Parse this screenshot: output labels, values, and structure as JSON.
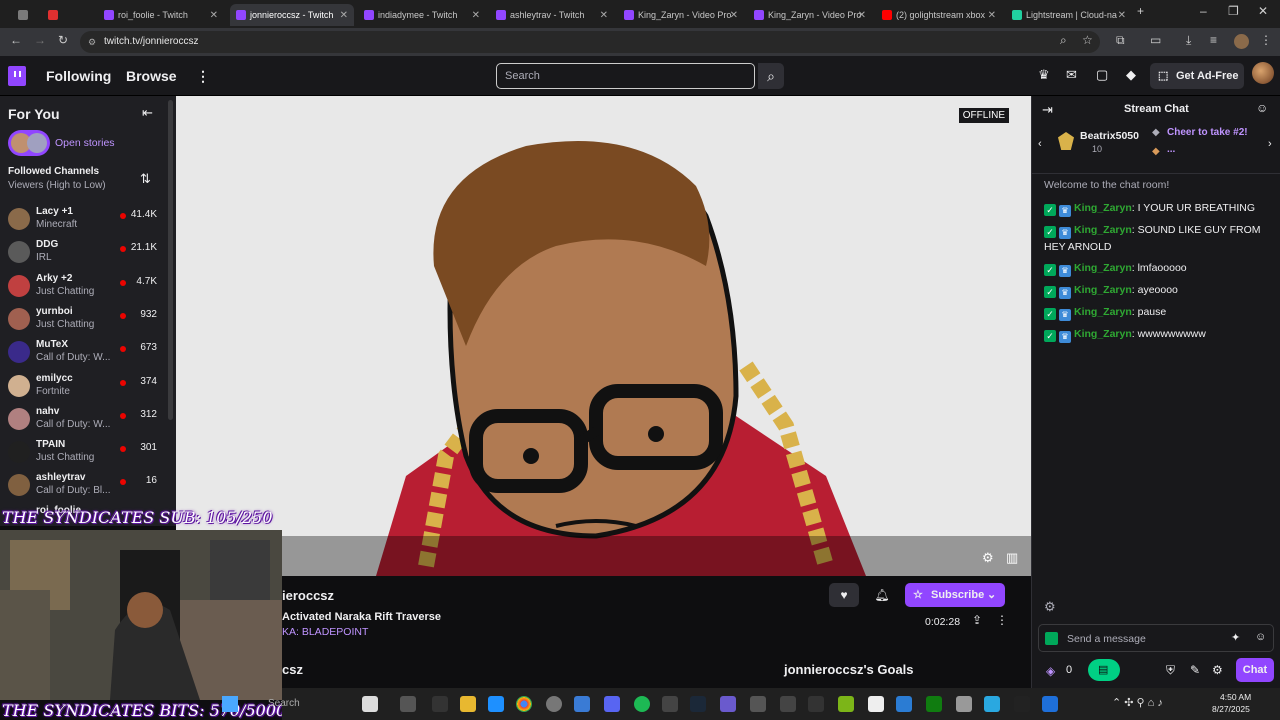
{
  "browser": {
    "tabs": [
      {
        "label": "",
        "color": "#7a7a7a"
      },
      {
        "label": "",
        "color": "#e03030"
      },
      {
        "label": "roi_foolie - Twitch",
        "color": "#9146ff"
      },
      {
        "label": "jonnieroccsz - Twitch",
        "color": "#9146ff"
      },
      {
        "label": "indiadymee - Twitch",
        "color": "#9146ff"
      },
      {
        "label": "ashleytrav - Twitch",
        "color": "#9146ff"
      },
      {
        "label": "King_Zaryn - Video Pro",
        "color": "#9146ff"
      },
      {
        "label": "King_Zaryn - Video Pro",
        "color": "#9146ff"
      },
      {
        "label": "(2) golightstream xbox",
        "color": "#ff0000"
      },
      {
        "label": "Lightstream | Cloud-na",
        "color": "#21d0a0"
      }
    ],
    "url": "twitch.tv/jonnieroccsz"
  },
  "nav": {
    "following": "Following",
    "browse": "Browse",
    "search_placeholder": "Search",
    "get_ad_free": "Get Ad-Free"
  },
  "sidebar": {
    "for_you": "For You",
    "open_stories": "Open stories",
    "followed_title": "Followed Channels",
    "followed_sort": "Viewers (High to Low)",
    "channels": [
      {
        "name": "Lacy +1",
        "game": "Minecraft",
        "viewers": "41.4K",
        "color": "#8a6a4a"
      },
      {
        "name": "DDG",
        "game": "IRL",
        "viewers": "21.1K",
        "color": "#5a5a5a"
      },
      {
        "name": "Arky +2",
        "game": "Just Chatting",
        "viewers": "4.7K",
        "color": "#c04040"
      },
      {
        "name": "yurnboi",
        "game": "Just Chatting",
        "viewers": "932",
        "color": "#a06050"
      },
      {
        "name": "MuTeX",
        "game": "Call of Duty: W...",
        "viewers": "673",
        "color": "#3a2a8a"
      },
      {
        "name": "emilycc",
        "game": "Fortnite",
        "viewers": "374",
        "color": "#d0b090"
      },
      {
        "name": "nahv",
        "game": "Call of Duty: W...",
        "viewers": "312",
        "color": "#b08080"
      },
      {
        "name": "TPAIN",
        "game": "Just Chatting",
        "viewers": "301",
        "color": "#202020"
      },
      {
        "name": "ashleytrav",
        "game": "Call of Duty: Bl...",
        "viewers": "16",
        "color": "#806040"
      }
    ],
    "partial_channel": "roi_foolie"
  },
  "player": {
    "offline": "OFFLINE"
  },
  "info": {
    "channel_name": "ieroccsz",
    "title": "Activated Naraka Rift Traverse",
    "game": "KA: BLADEPOINT",
    "time": "0:02:28",
    "subscribe": "Subscribe",
    "about_partial": "csz",
    "goals": "jonnieroccsz's Goals"
  },
  "chat": {
    "title": "Stream Chat",
    "leader_name": "Beatrix5050",
    "leader_count": "10",
    "cheer": "Cheer to take #2!",
    "cheer_more": "...",
    "welcome": "Welcome to the chat room!",
    "messages": [
      {
        "user": "King_Zaryn",
        "text": ": I YOUR UR BREATHING"
      },
      {
        "user": "King_Zaryn",
        "text": ": SOUND LIKE GUY FROM HEY ARNOLD"
      },
      {
        "user": "King_Zaryn",
        "text": ": lmfaooooo"
      },
      {
        "user": "King_Zaryn",
        "text": ": ayeoooo"
      },
      {
        "user": "King_Zaryn",
        "text": ": pause"
      },
      {
        "user": "King_Zaryn",
        "text": ": wwwwwwwww"
      }
    ],
    "placeholder": "Send a message",
    "points": "0",
    "chat_button": "Chat"
  },
  "overlay": {
    "subs": "THE SYNDICATES SUB: 105/250",
    "bits": "THE SYNDICATES BITS: 570/5000"
  },
  "taskbar": {
    "search": "Search",
    "time": "4:50 AM",
    "date": "8/27/2025"
  }
}
